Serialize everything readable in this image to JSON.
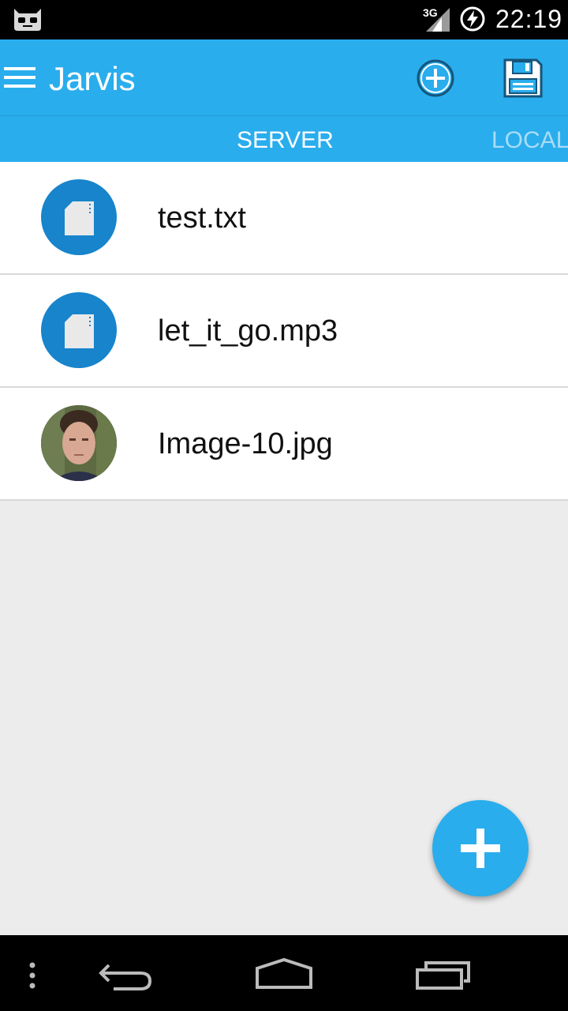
{
  "status_bar": {
    "network_label": "3G",
    "time": "22:19",
    "icons": [
      "cyanogenmod-robot-icon",
      "signal-icon",
      "battery-charging-icon"
    ]
  },
  "app_bar": {
    "title": "Jarvis",
    "icons": [
      "menu-icon",
      "add-circle-icon",
      "save-icon"
    ]
  },
  "tabs": [
    {
      "label": "SERVER",
      "selected": true
    },
    {
      "label": "LOCAL",
      "selected": false
    }
  ],
  "files": [
    {
      "name": "test.txt",
      "icon": "file-icon"
    },
    {
      "name": "let_it_go.mp3",
      "icon": "file-icon"
    },
    {
      "name": "Image-10.jpg",
      "icon": "image-thumbnail"
    }
  ],
  "fab": {
    "icon": "plus-icon"
  },
  "nav_bar": {
    "icons": [
      "overflow-menu-icon",
      "back-icon",
      "home-icon",
      "recents-icon"
    ]
  },
  "colors": {
    "primary": "#29aded",
    "file_icon_bg": "#1784cc",
    "background": "#ececec"
  }
}
